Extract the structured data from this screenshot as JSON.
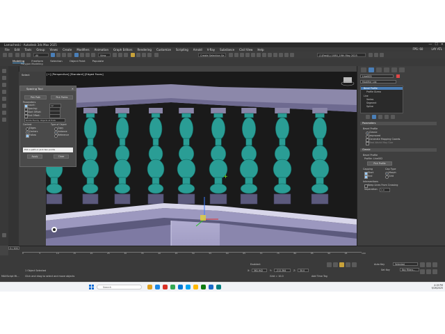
{
  "window": {
    "title": "Lamacheski - Autodesk 3ds Max 2025",
    "controls": [
      "—",
      "☐",
      "✕"
    ]
  },
  "menu": {
    "items": [
      "File",
      "Edit",
      "Tools",
      "Group",
      "Views",
      "Create",
      "Modifiers",
      "Animation",
      "Graph Editors",
      "Rendering",
      "Customize",
      "Scripting",
      "Arnold",
      "V-Ray",
      "Substance",
      "Civil View",
      "Help"
    ],
    "right": [
      "FPS: 60",
      "LAY ATL",
      "FPS: 60",
      "LAY ATL"
    ]
  },
  "toolbar": {
    "view_dropdown": "View",
    "selection_set": "Create Selection Se",
    "workspace": "(1)Fast(L) 1080_19th May 2025"
  },
  "ribbon": {
    "tabs": [
      "Modeling",
      "Freeform",
      "Selection",
      "Object Paint",
      "Populate"
    ],
    "active_tab": "Modeling",
    "subtitle": "Polygon Modeling"
  },
  "viewport": {
    "label": "[+] [Perspective] [Standard] [Edged Faces]",
    "left_panel_label": "Select",
    "colors": {
      "balustrade": "#2a9d95",
      "rail_top": "#8a86a8",
      "base": "#5c5a7d",
      "wall": "#9c98bf",
      "mesh_line": "#0e5e58"
    }
  },
  "spacing_tool": {
    "title": "Spacing Tool",
    "pick_path": "Pick Path",
    "pick_points": "Pick Points",
    "parameters_label": "Parameters",
    "params": [
      {
        "label": "Count:",
        "checked": true
      },
      {
        "label": "Spacing:",
        "checked": false
      },
      {
        "label": "Start Offset:",
        "checked": false
      },
      {
        "label": "End Offset:",
        "checked": false
      }
    ],
    "count_value": "12",
    "divide_label": "Divide Evenly, Objects at Ends",
    "context_label": "Context",
    "context_options": [
      {
        "label": "Edges",
        "selected": false
      },
      {
        "label": "Centers",
        "selected": true
      },
      {
        "label": "Follow",
        "selected": true
      }
    ],
    "type_label": "Type of Object",
    "type_options": [
      {
        "label": "Copy",
        "selected": false
      },
      {
        "label": "Instance",
        "selected": true
      },
      {
        "label": "Reference",
        "selected": false
      }
    ],
    "status": "Pick a path or pick two points",
    "apply": "Apply",
    "close": "Close"
  },
  "command_panel": {
    "object_name": "Line003",
    "modifier_list": "Modifier List",
    "stack": [
      {
        "label": "Bevel Profile",
        "selected": true
      },
      {
        "label": "Profile Gizmo",
        "selected": false
      },
      {
        "label": "Line",
        "selected": false
      },
      {
        "label": "Vertex",
        "selected": false
      },
      {
        "label": "Segment",
        "selected": false
      },
      {
        "label": "Spline",
        "selected": false
      }
    ],
    "parameters_label": "Parameters",
    "bevel_profile_label": "Bevel Profile",
    "classic_label": "Classic",
    "improved_label": "Improved",
    "gen_mapping": "Generate Mapping Coords.",
    "real_world": "Real-World Map Size",
    "classic_section": "Classic",
    "bevel_profile2": "Bevel Profile",
    "profile_name": "Profile: Line002",
    "pick_profile": "Pick Profile",
    "capping_label": "Capping",
    "cap_type_label": "Cap Type",
    "start": "Start",
    "end": "End",
    "morph": "Morph",
    "grid": "Grid",
    "intersections": "Intersections",
    "keep_lines": "Keep Lines From Crossing",
    "separation_label": "Separation:",
    "separation_value": "1.0"
  },
  "timeline": {
    "frame": "0 / 100",
    "ticks": [
      "0",
      "5",
      "10",
      "15",
      "20",
      "25",
      "30",
      "35",
      "40",
      "45",
      "50",
      "55",
      "60",
      "65",
      "70",
      "75",
      "80",
      "85",
      "90",
      "95",
      "100"
    ]
  },
  "status": {
    "selected": "1 Object Selected",
    "hint": "Click and drag to select and move objects",
    "maxscript": "MAXScript Mi...",
    "x_label": "X:",
    "x": "561.942",
    "y_label": "Y:",
    "y": "-212.364",
    "z_label": "Z:",
    "z": "30.0",
    "grid": "Grid = 10.0",
    "add_time_tag": "Add Time Tag",
    "auto_key": "Auto Key",
    "selected_dd": "Selected",
    "set_key": "Set Key",
    "key_filters": "Key Filters...",
    "enabled": "Enabled:"
  },
  "taskbar": {
    "search": "Search",
    "time": "4:19 PM",
    "date": "9/26/2025",
    "icon_colors": [
      "#e0a020",
      "#1e88e5",
      "#d93025",
      "#34a853",
      "#0078d4",
      "#00a4ef",
      "#ffb900",
      "#107c10",
      "#1b6ac9",
      "#008080"
    ]
  }
}
